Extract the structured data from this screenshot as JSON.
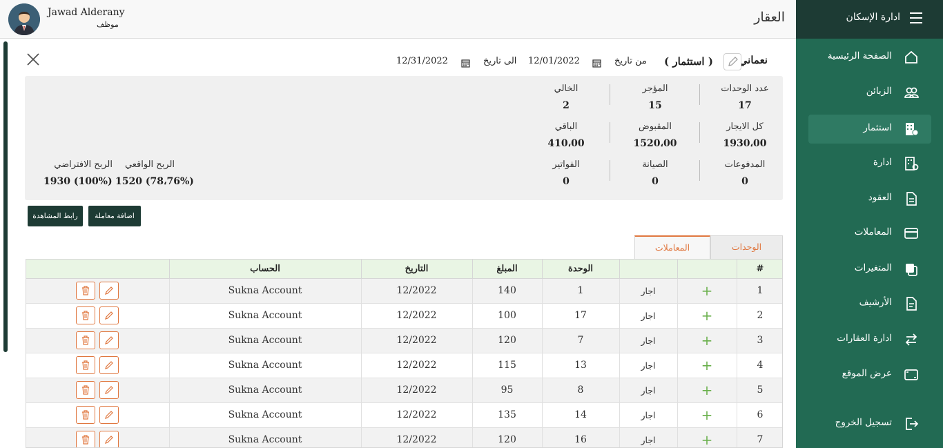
{
  "sidebar": {
    "title": "ادارة الإسكان",
    "items": [
      {
        "label": "الصفحة الرئيسية",
        "icon": "home-icon"
      },
      {
        "label": "الزبائن",
        "icon": "users-icon"
      },
      {
        "label": "استثمار",
        "icon": "building-icon"
      },
      {
        "label": "ادارة",
        "icon": "building-settings-icon"
      },
      {
        "label": "العقود",
        "icon": "document-icon"
      },
      {
        "label": "المعاملات",
        "icon": "card-icon"
      },
      {
        "label": "المتغيرات",
        "icon": "copy-icon"
      },
      {
        "label": "الأرشيف",
        "icon": "archive-icon"
      },
      {
        "label": "ادارة العقارات",
        "icon": "arrows-icon"
      },
      {
        "label": "عرض الموقع",
        "icon": "screen-icon"
      },
      {
        "label": "تسجيل الخروج",
        "icon": "logout-icon"
      }
    ],
    "active_index": 2
  },
  "header": {
    "page_title": "العقار",
    "user_name": "Jawad Alderany",
    "user_role": "موظف"
  },
  "property": {
    "name": "نعماني",
    "type": "( استثمار )",
    "from_label": "من تاريخ",
    "from_date": "12/01/2022",
    "to_label": "الى تاريخ",
    "to_date": "12/31/2022"
  },
  "stats": {
    "units_label": "عدد الوحدات",
    "units": "17",
    "rented_label": "المؤجر",
    "rented": "15",
    "vacant_label": "الخالي",
    "vacant": "2",
    "total_rent_label": "كل الايجار",
    "total_rent": "1930،00",
    "received_label": "المقبوض",
    "received": "1520،00",
    "remaining_label": "الباقي",
    "remaining": "410،00",
    "payments_label": "المدفوعات",
    "payments": "0",
    "maintenance_label": "الصيانة",
    "maintenance": "0",
    "bills_label": "الفواتير",
    "bills": "0",
    "actual_profit_label": "الربح الواقعي",
    "actual_profit": "1520 (78،76%)",
    "virtual_profit_label": "الربح الافتراضي",
    "virtual_profit": "1930 (100%)"
  },
  "buttons": {
    "add_transaction": "اضافة معاملة",
    "view_link": "رابط المشاهدة"
  },
  "tabs": {
    "units": "الوحدات",
    "transactions": "المعاملات"
  },
  "table": {
    "headers": {
      "num": "#",
      "plus": "",
      "type": "",
      "unit": "الوحدة",
      "amount": "المبلغ",
      "date": "التاريخ",
      "account": "الحساب",
      "actions": ""
    },
    "rows": [
      {
        "num": "1",
        "type": "اجار",
        "unit": "1",
        "amount": "140",
        "date": "12/2022",
        "account": "Sukna Account"
      },
      {
        "num": "2",
        "type": "اجار",
        "unit": "17",
        "amount": "100",
        "date": "12/2022",
        "account": "Sukna Account"
      },
      {
        "num": "3",
        "type": "اجار",
        "unit": "7",
        "amount": "120",
        "date": "12/2022",
        "account": "Sukna Account"
      },
      {
        "num": "4",
        "type": "اجار",
        "unit": "13",
        "amount": "115",
        "date": "12/2022",
        "account": "Sukna Account"
      },
      {
        "num": "5",
        "type": "اجار",
        "unit": "8",
        "amount": "95",
        "date": "12/2022",
        "account": "Sukna Account"
      },
      {
        "num": "6",
        "type": "اجار",
        "unit": "14",
        "amount": "135",
        "date": "12/2022",
        "account": "Sukna Account"
      },
      {
        "num": "7",
        "type": "اجار",
        "unit": "16",
        "amount": "120",
        "date": "12/2022",
        "account": "Sukna Account"
      }
    ],
    "plus_symbol": "+"
  },
  "colors": {
    "sidebar": "#226a53",
    "sidebar_dark": "#1d3b34",
    "accent": "#e0773f",
    "header_green": "#e9f5e4"
  }
}
